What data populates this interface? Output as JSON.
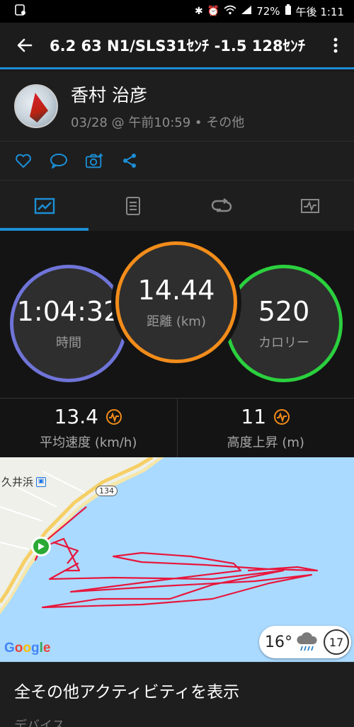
{
  "status_bar": {
    "battery": "72%",
    "time": "午後 1:11"
  },
  "header": {
    "title": "6.2 63 N1/SLS31ｾﾝﾁ   -1.5 128ｾﾝﾁ",
    "accent": "#1c8fd6"
  },
  "profile": {
    "name": "香村 治彦",
    "meta": "03/28 @ 午前10:59 • その他"
  },
  "actions": [
    "like-icon",
    "comment-icon",
    "add-photo-icon",
    "share-icon"
  ],
  "tabs": [
    "summary-chart-icon",
    "details-icon",
    "laps-icon",
    "graph-icon"
  ],
  "stats": {
    "time": {
      "value": "1:04:32",
      "label": "時間",
      "color": "#6f74d8"
    },
    "distance": {
      "value": "14.44",
      "label": "距離 (km)",
      "color": "#f28c1a"
    },
    "calories": {
      "value": "520",
      "label": "カロリー",
      "color": "#2bd03e"
    }
  },
  "secondary": {
    "avg_speed": {
      "value": "13.4",
      "label": "平均速度 (km/h)"
    },
    "elevation_gain": {
      "value": "11",
      "label": "高度上昇 (m)"
    }
  },
  "map": {
    "place_label": "久井浜",
    "road_number": "134",
    "weather_temp": "16°",
    "wind_speed": "17",
    "attribution": "Google",
    "track_color": "#e8163c"
  },
  "more_activities": "全その他アクティビティを表示",
  "device_label": "デバイス"
}
